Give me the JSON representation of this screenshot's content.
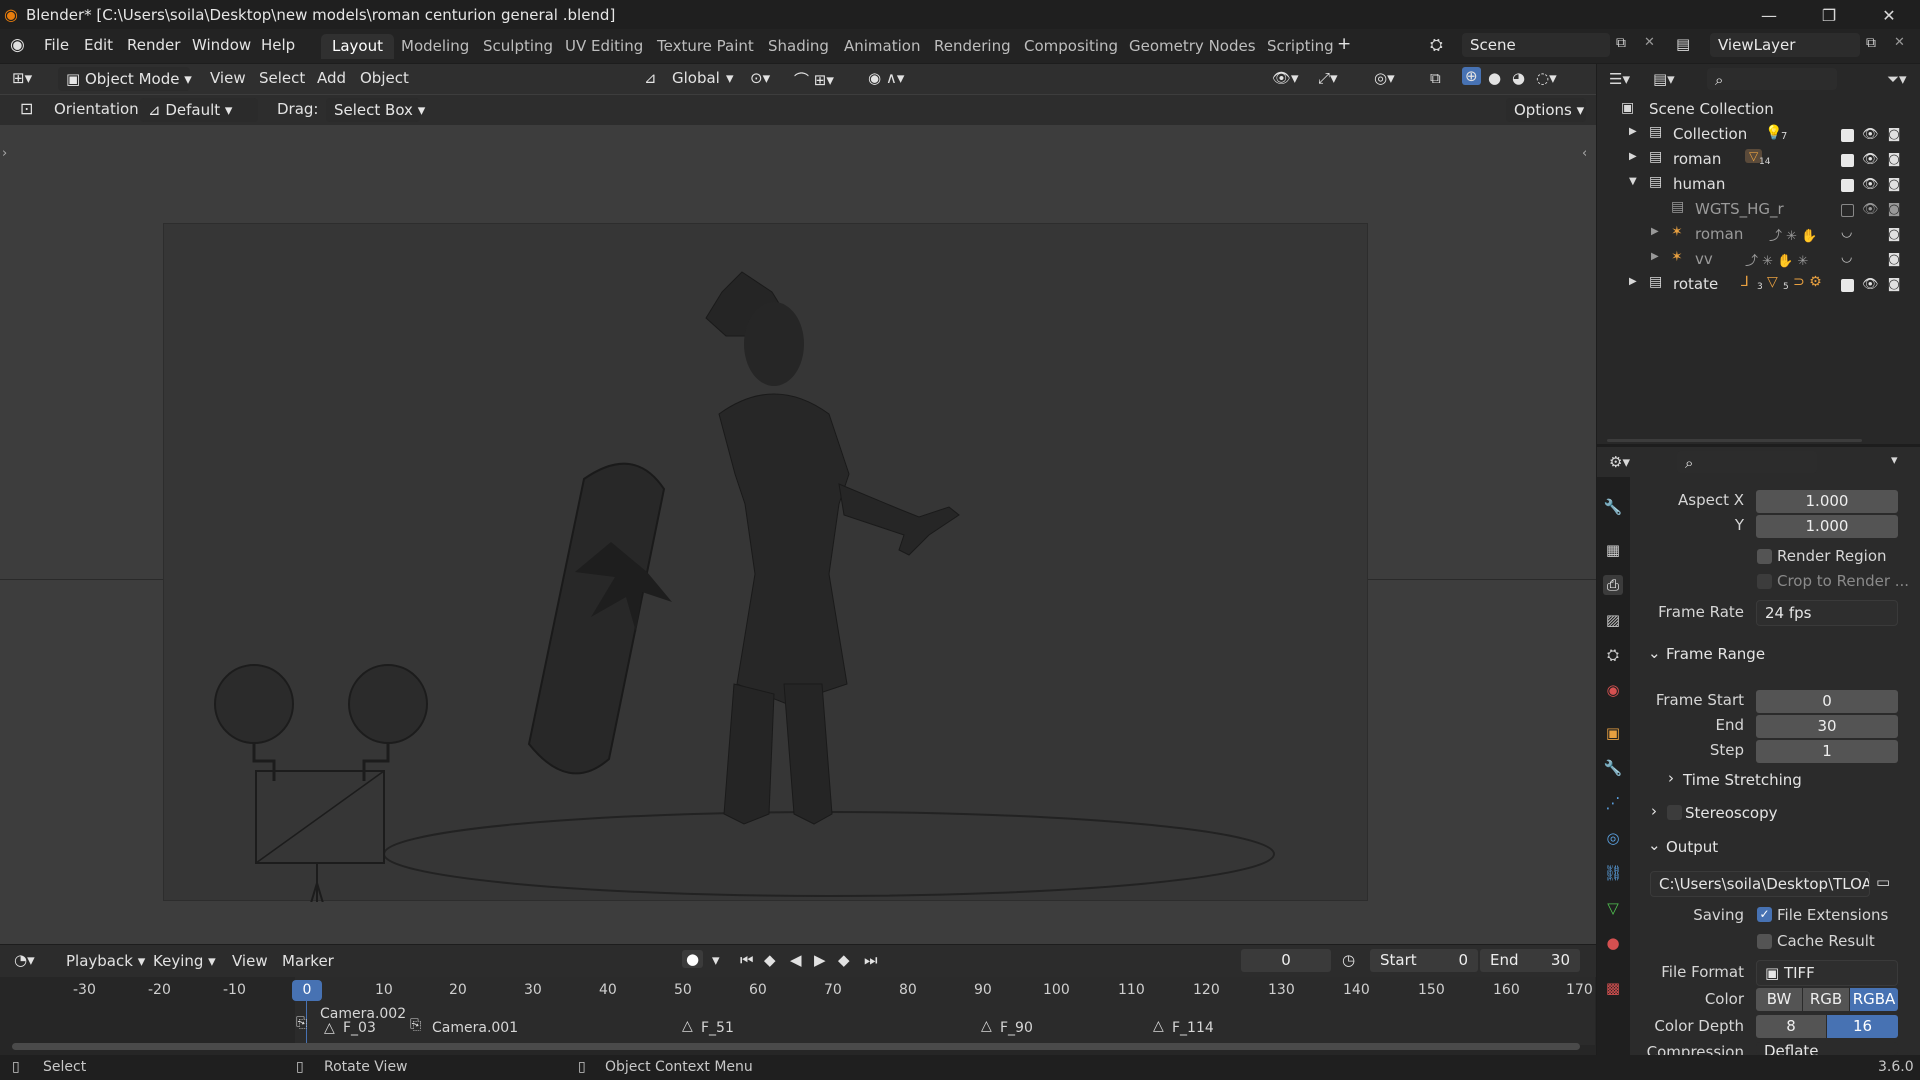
{
  "window": {
    "title": "Blender* [C:\\Users\\soila\\Desktop\\new models\\roman centurion general .blend]",
    "minimize": "—",
    "maximize": "❐",
    "close": "✕"
  },
  "menubar": {
    "items": [
      "File",
      "Edit",
      "Render",
      "Window",
      "Help"
    ],
    "workspaces": [
      "Layout",
      "Modeling",
      "Sculpting",
      "UV Editing",
      "Texture Paint",
      "Shading",
      "Animation",
      "Rendering",
      "Compositing",
      "Geometry Nodes",
      "Scripting"
    ],
    "active_workspace": "Layout",
    "add_workspace": "+",
    "scene": "Scene",
    "view_layer": "ViewLayer"
  },
  "viewport_header": {
    "mode": "Object Mode",
    "menus": [
      "View",
      "Select",
      "Add",
      "Object"
    ],
    "transform_orientation": "Global"
  },
  "tool_settings": {
    "orientation_label": "Orientation:",
    "orientation_value": "Default",
    "drag_label": "Drag:",
    "drag_value": "Select Box",
    "options": "Options"
  },
  "outliner": {
    "root": "Scene Collection",
    "rows": [
      {
        "label": "Collection",
        "badge": "7"
      },
      {
        "label": "roman",
        "badge": "14"
      },
      {
        "label": "human",
        "badge": ""
      },
      {
        "label": "WGTS_HG_r",
        "badge": ""
      },
      {
        "label": "roman",
        "badge": ""
      },
      {
        "label": "vv",
        "badge": ""
      },
      {
        "label": "rotate",
        "badge": "3"
      }
    ],
    "rotate_badge2": "5"
  },
  "properties": {
    "aspect_x_label": "Aspect X",
    "aspect_x": "1.000",
    "aspect_y_label": "Y",
    "aspect_y": "1.000",
    "render_region": "Render Region",
    "crop_to_render": "Crop to Render ...",
    "frame_rate_label": "Frame Rate",
    "frame_rate": "24 fps",
    "frame_range_title": "Frame Range",
    "frame_start_label": "Frame Start",
    "frame_start": "0",
    "end_label": "End",
    "end": "30",
    "step_label": "Step",
    "step": "1",
    "time_stretching": "Time Stretching",
    "stereoscopy": "Stereoscopy",
    "output_title": "Output",
    "output_path": "C:\\Users\\soila\\Desktop\\TLOA\\r...",
    "saving_label": "Saving",
    "file_extensions": "File Extensions",
    "cache_result": "Cache Result",
    "file_format_label": "File Format",
    "file_format": "TIFF",
    "color_label": "Color",
    "color_options": [
      "BW",
      "RGB",
      "RGBA"
    ],
    "color_active": "RGBA",
    "color_depth_label": "Color Depth",
    "color_depth_options": [
      "8",
      "16"
    ],
    "color_depth_active": "16",
    "compression_label": "Compression",
    "compression": "Deflate"
  },
  "timeline": {
    "menus": [
      "Playback",
      "Keying",
      "View",
      "Marker"
    ],
    "current_frame": "0",
    "start_label": "Start",
    "start": "0",
    "end_label": "End",
    "end": "30",
    "ticks": [
      "-30",
      "-20",
      "-10",
      "0",
      "10",
      "20",
      "30",
      "40",
      "50",
      "60",
      "70",
      "80",
      "90",
      "100",
      "110",
      "120",
      "130",
      "140",
      "150",
      "160",
      "170"
    ],
    "playhead": "0",
    "markers": [
      "Camera.002",
      "F_03",
      "Camera.001",
      "F_51",
      "F_90",
      "F_114"
    ]
  },
  "statusbar": {
    "select": "Select",
    "rotate_view": "Rotate View",
    "context_menu": "Object Context Menu",
    "version": "3.6.0"
  },
  "colors": {
    "accent": "#4772b3",
    "active_frame": "#4772b3"
  }
}
